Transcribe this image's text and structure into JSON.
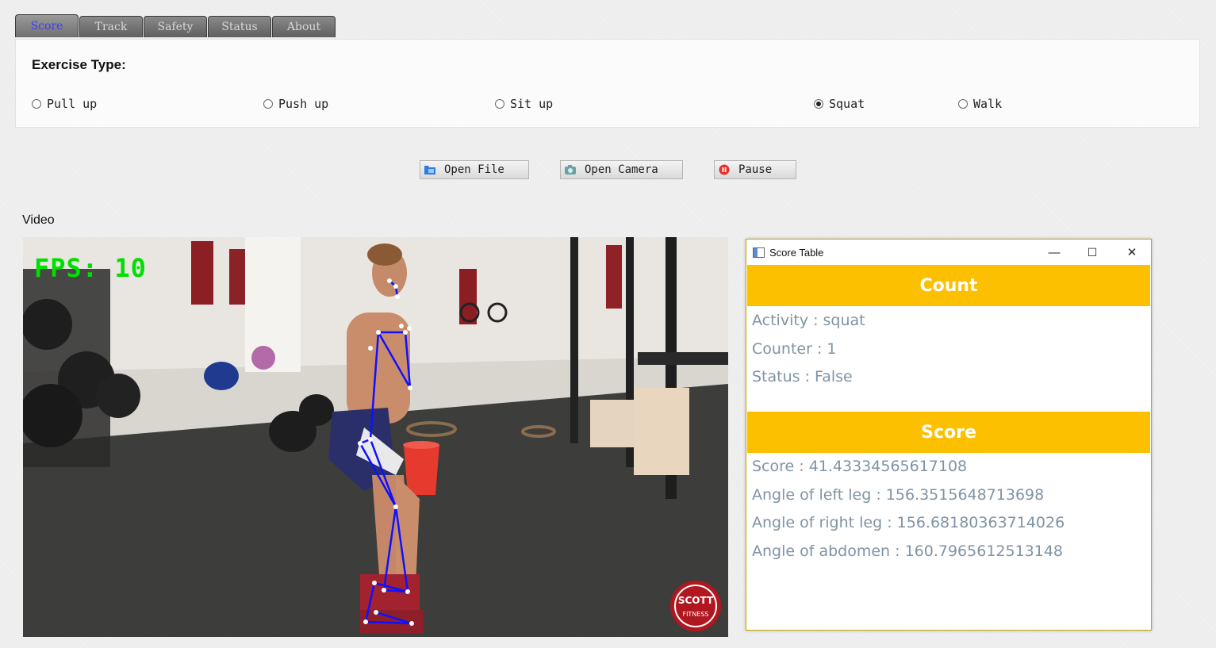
{
  "tabs": [
    {
      "label": "Score",
      "active": true
    },
    {
      "label": "Track",
      "active": false
    },
    {
      "label": "Safety",
      "active": false
    },
    {
      "label": "Status",
      "active": false
    },
    {
      "label": "About",
      "active": false
    }
  ],
  "exercise": {
    "title": "Exercise Type:",
    "options": [
      {
        "label": "Pull up",
        "checked": false
      },
      {
        "label": "Push up",
        "checked": false
      },
      {
        "label": "Sit up",
        "checked": false
      },
      {
        "label": "Squat",
        "checked": true
      },
      {
        "label": "Walk",
        "checked": false
      }
    ]
  },
  "buttons": {
    "open_file": "Open File",
    "open_camera": "Open Camera",
    "pause": "Pause"
  },
  "video": {
    "label": "Video",
    "fps_text": "FPS: 10"
  },
  "score_window": {
    "title": "Score Table",
    "minimize": "—",
    "maximize": "☐",
    "close": "✕",
    "count_header": "Count",
    "activity": "Activity : squat",
    "counter": "Counter : 1",
    "status": "Status : False",
    "score_header": "Score",
    "score": "Score : 41.43334565617108",
    "left_leg": "Angle of left leg : 156.3515648713698",
    "right_leg": "Angle of right leg : 156.68180363714026",
    "abdomen": "Angle of abdomen : 160.7965612513148"
  },
  "colors": {
    "band": "#fdc000",
    "stat_text": "#7f93a6",
    "active_tab_text": "#3b3bff",
    "fps_green": "#00e000",
    "skeleton_blue": "#1010ff"
  }
}
